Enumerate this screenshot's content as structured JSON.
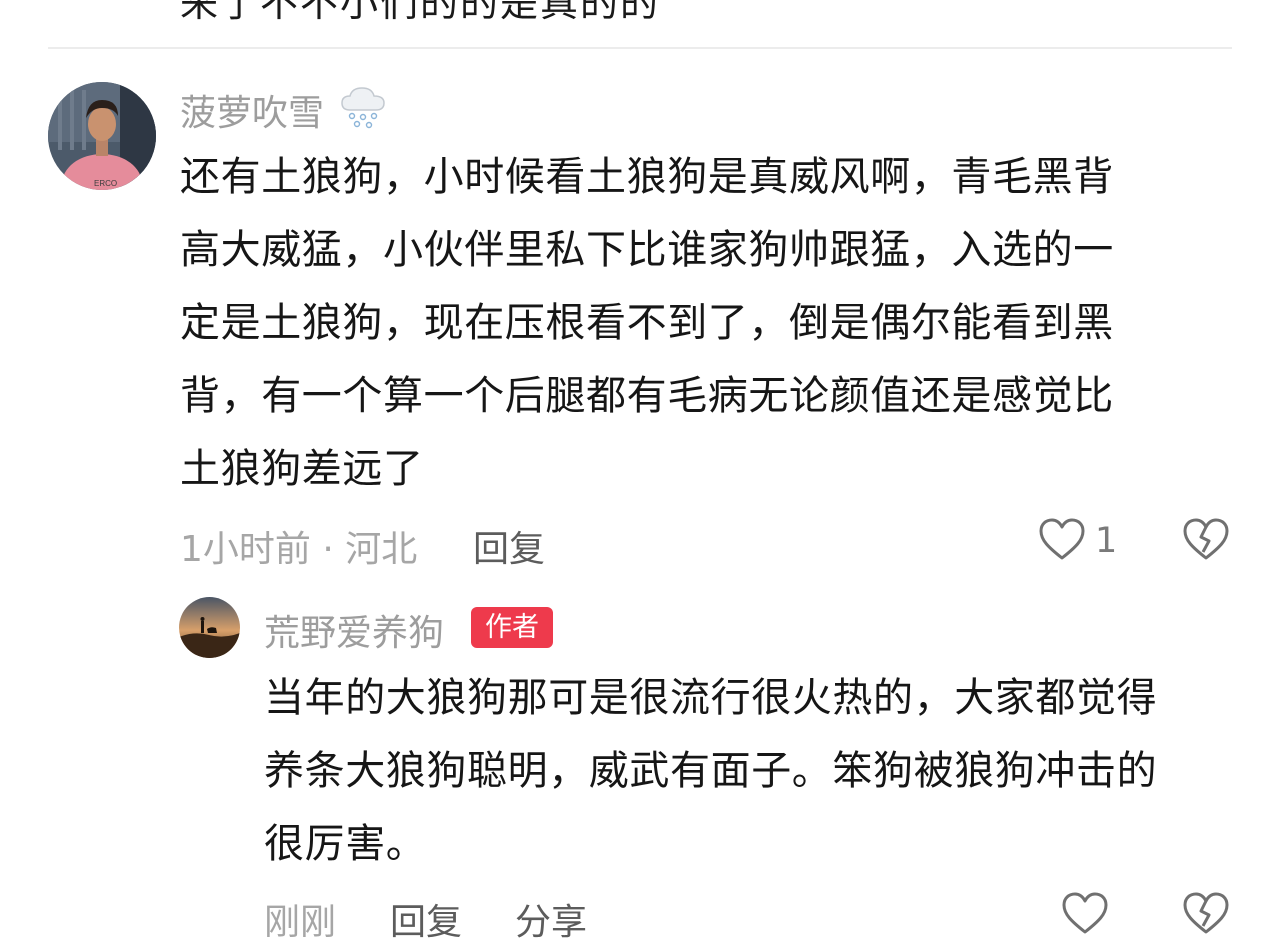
{
  "previous_comment_fragment": "来了不不小们的的是真的的",
  "comment": {
    "username": "菠萝吹雪",
    "username_icon": "snow-cloud-icon",
    "lines": [
      "还有土狼狗，小时候看土狼狗是真威风啊，青毛黑背",
      "高大威猛，小伙伴里私下比谁家狗帅跟猛，入选的一",
      "定是土狼狗，现在压根看不到了，倒是偶尔能看到黑",
      "背，有一个算一个后腿都有毛病无论颜值还是感觉比",
      "土狼狗差远了"
    ],
    "time_location": "1小时前 · 河北",
    "reply_label": "回复",
    "like_count": "1",
    "like_icon": "heart-icon",
    "dislike_icon": "broken-heart-icon"
  },
  "reply": {
    "username": "荒野爱养狗",
    "badge": "作者",
    "lines": [
      "当年的大狼狗那可是很流行很火热的，大家都觉得",
      "养条大狼狗聪明，威武有面子。笨狗被狼狗冲击的",
      "很厉害。"
    ],
    "time": "刚刚",
    "reply_label": "回复",
    "share_label": "分享",
    "like_icon": "heart-icon",
    "dislike_icon": "broken-heart-icon"
  },
  "colors": {
    "badge": "#ee3a4c",
    "username": "#9d9d9d",
    "meta_light": "#a6a6a6",
    "meta_dark": "#5c5c5c",
    "divider": "#ececec"
  }
}
